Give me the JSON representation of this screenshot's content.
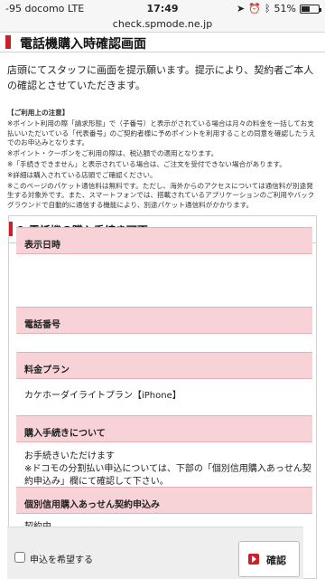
{
  "status": {
    "signal": "-95",
    "carrier": "docomo",
    "network": "LTE",
    "time": "17:49",
    "battery": "51%",
    "battery_level": 0.51
  },
  "browser": {
    "url": "check.spmode.ne.jp"
  },
  "page": {
    "title": "電話機購入時確認画面",
    "intro": "店頭にてスタッフに画面を提示願います。提示により、契約者ご本人の確認とさせていただきます。",
    "notes_head": "【ご利用上の注意】",
    "notes": [
      "※ポイント利用の際「請求形態」で（子番号）と表示がされている場合は月々の料金を一括してお支払いいただいている「代表番号」のご契約者様に予めポイントを利用することの同意を確認したうえでのお申込みとなります。",
      "※ポイント・クーポンをご利用の際は、税込額での適用となります。",
      "※「手続きできません」と表示されている場合は、ご注文を受付できない場合があります。",
      "※詳細は購入されている店頭でご確認ください。",
      "※このページのパケット通信料は無料です。ただし、海外からのアクセスについては通信料が別途発生する対象外です。また、スマートフォンでは、搭載されているアプリケーションのご利用やバックグラウンドで自動的に通信する機能により、別途パケット通信料がかかります。"
    ]
  },
  "section": {
    "title": "1.電話機の購入手続き可否",
    "rows": [
      {
        "label": "表示日時",
        "value": ""
      },
      {
        "label": "電話番号",
        "value": ""
      },
      {
        "label": "料金プラン",
        "value": "カケホーダイライトプラン【iPhone】"
      },
      {
        "label": "購入手続きについて",
        "value_line1": "お手続きいただけます",
        "value_line2": "※ドコモの分割払い申込については、下部の「個別信用購入あっせん契約申込み」欄にて確認して下さい。"
      },
      {
        "label": "個別信用購入あっせん契約申込み",
        "value": "契約中"
      }
    ]
  },
  "form": {
    "checkbox_label": "申込を希望する",
    "confirm_label": "確認"
  },
  "colors": {
    "accent": "#cc1f28",
    "row_bg": "#f7d2d7"
  }
}
